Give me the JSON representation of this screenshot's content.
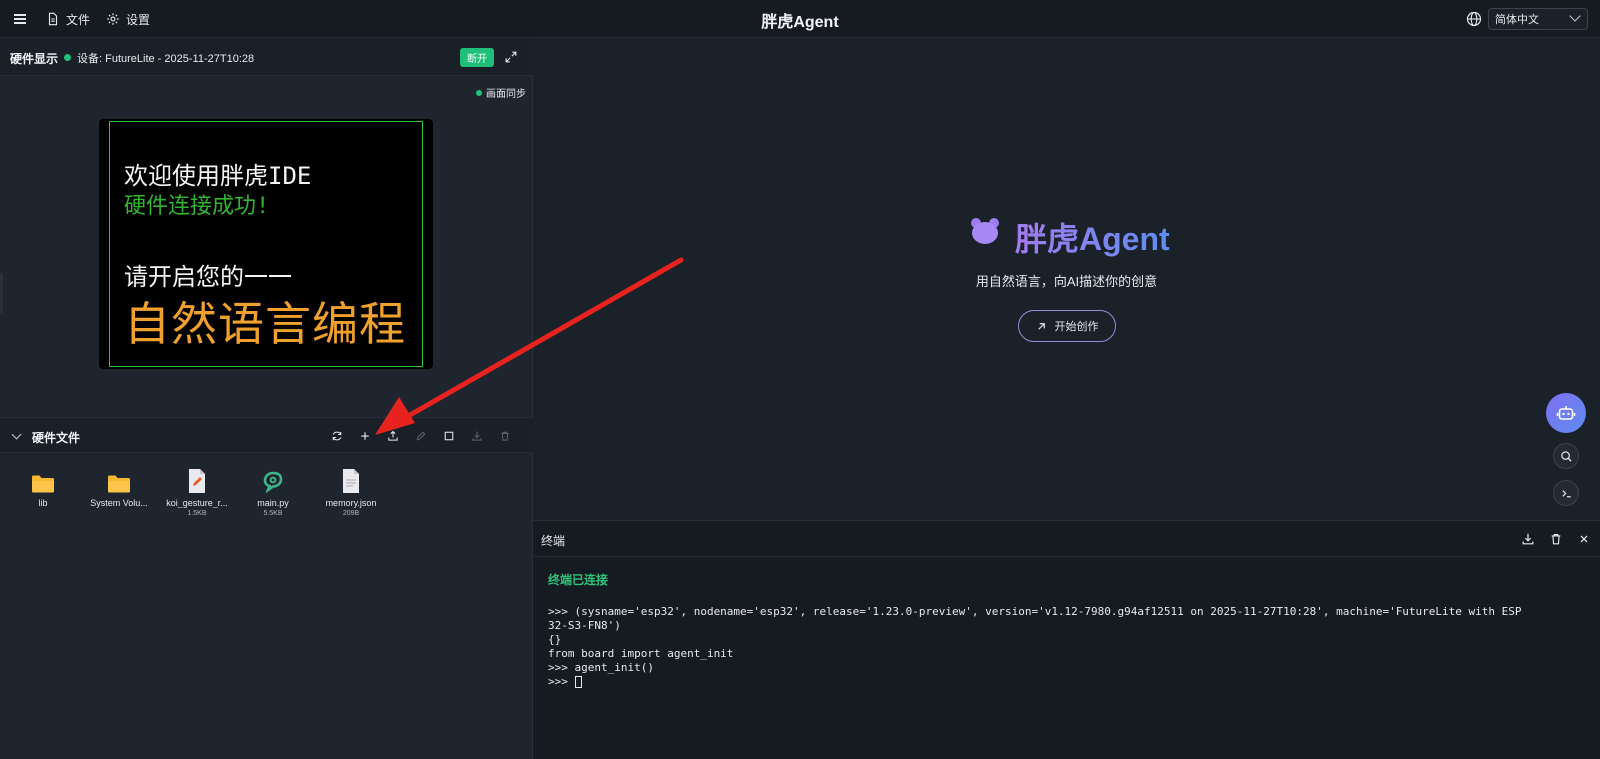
{
  "topbar": {
    "file_label": "文件",
    "settings_label": "设置",
    "app_title": "胖虎Agent",
    "language": "简体中文"
  },
  "hardware": {
    "title": "硬件显示",
    "device": "设备: FutureLite - 2025-11-27T10:28",
    "disconnect_label": "断开",
    "sync_label": "画面同步",
    "screen_lines": [
      "欢迎使用胖虎IDE",
      "硬件连接成功!",
      "请开启您的一一",
      "自然语言编程"
    ]
  },
  "files": {
    "title": "硬件文件",
    "items": [
      {
        "name": "lib",
        "size": "",
        "type": "folder"
      },
      {
        "name": "System Volu...",
        "size": "",
        "type": "folder"
      },
      {
        "name": "koi_gesture_r...",
        "size": "1.5KB",
        "type": "file-edit"
      },
      {
        "name": "main.py",
        "size": "5.5KB",
        "type": "python"
      },
      {
        "name": "memory.json",
        "size": "209B",
        "type": "file"
      }
    ]
  },
  "welcome": {
    "title": "胖虎Agent",
    "subtitle": "用自然语言，向AI描述你的创意",
    "start_label": "开始创作"
  },
  "terminal": {
    "title": "终端",
    "connected": "终端已连接",
    "lines": [
      ">>> (sysname='esp32', nodename='esp32', release='1.23.0-preview', version='v1.12-7980.g94af12511 on 2025-11-27T10:28', machine='FutureLite with ESP\n32-S3-FN8')",
      "{}",
      "from board import agent_init",
      ">>> agent_init()",
      ">>> "
    ]
  },
  "colors": {
    "accent_green": "#1fbf7a",
    "brand_gradient_start": "#a47bf0",
    "brand_gradient_end": "#5d8df0",
    "annotation_red": "#e8231f"
  }
}
